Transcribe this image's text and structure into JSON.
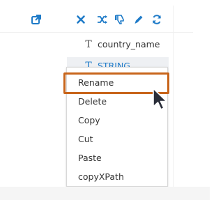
{
  "toolbar": {
    "icons": [
      {
        "name": "open-external-icon"
      },
      {
        "name": "close-icon"
      },
      {
        "name": "shuffle-icon"
      },
      {
        "name": "dislike-icon"
      },
      {
        "name": "edit-icon"
      },
      {
        "name": "refresh-icon"
      }
    ],
    "accent_color": "#1f7bc8"
  },
  "tree": {
    "rows": [
      {
        "label": "country_name",
        "icon": "text-type-icon"
      },
      {
        "label": "STRING",
        "icon": "text-type-icon",
        "selected": true
      }
    ]
  },
  "context_menu": {
    "items": [
      {
        "label": "Rename",
        "highlighted": true
      },
      {
        "label": "Delete"
      },
      {
        "label": "Copy"
      },
      {
        "label": "Cut"
      },
      {
        "label": "Paste"
      },
      {
        "label": "copyXPath"
      }
    ],
    "highlight_color": "#c8651b"
  },
  "glyphs": {
    "text_type": "T"
  }
}
